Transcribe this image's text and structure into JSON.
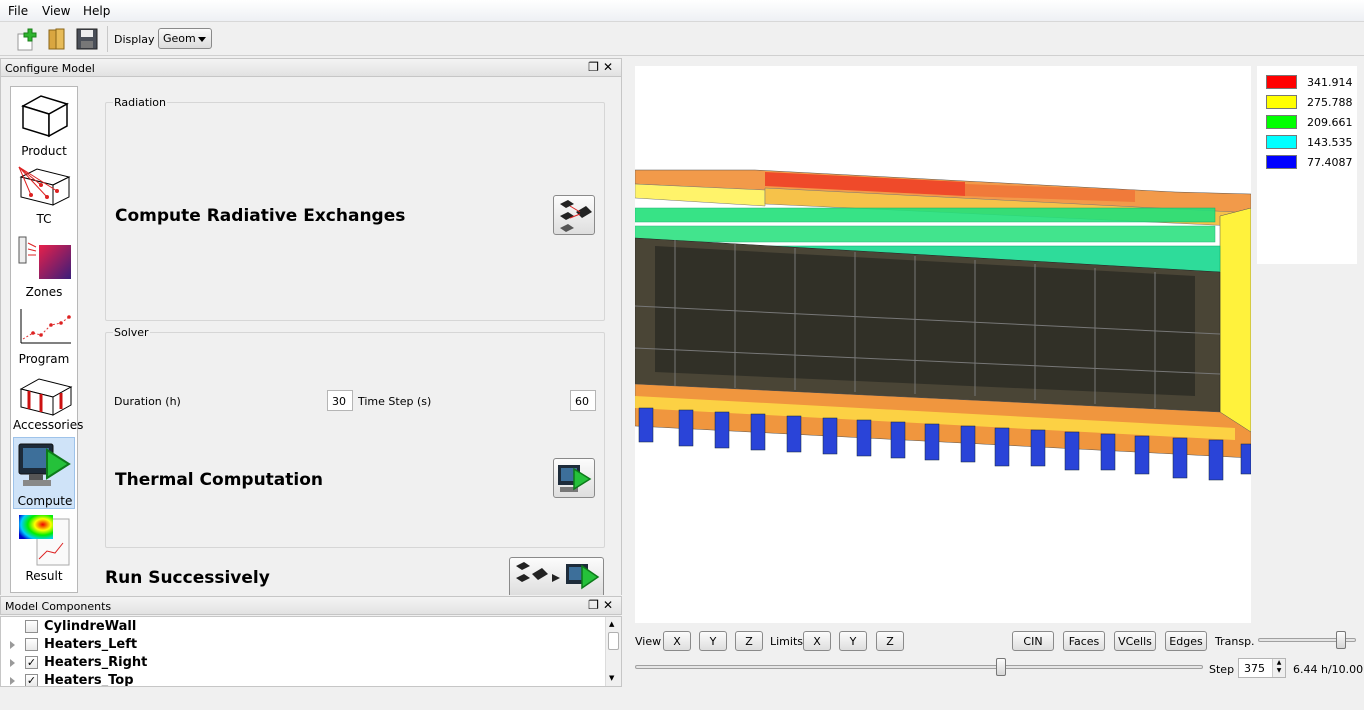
{
  "menu": {
    "items": [
      "File",
      "View",
      "Help"
    ]
  },
  "toolbar": {
    "display_label": "Display :",
    "display_value": "Geom"
  },
  "configure": {
    "title": "Configure Model",
    "nav": [
      {
        "label": "Product",
        "icon": "box-icon"
      },
      {
        "label": "TC",
        "icon": "thermocouple-icon"
      },
      {
        "label": "Zones",
        "icon": "heater-zone-icon"
      },
      {
        "label": "Program",
        "icon": "program-plot-icon"
      },
      {
        "label": "Accessories",
        "icon": "accessories-icon"
      },
      {
        "label": "Compute",
        "icon": "compute-play-icon"
      },
      {
        "label": "Result",
        "icon": "result-colormap-icon"
      }
    ],
    "radiation": {
      "group_title": "Radiation",
      "heading": "Compute Radiative Exchanges"
    },
    "solver": {
      "group_title": "Solver",
      "duration_label": "Duration (h)",
      "duration_value": "30",
      "timestep_label": "Time Step (s)",
      "timestep_value": "60",
      "heading": "Thermal Computation"
    },
    "run": {
      "heading": "Run Successively"
    }
  },
  "components": {
    "title": "Model Components",
    "items": [
      {
        "name": "CylindreWall",
        "checked": false,
        "expandable": false
      },
      {
        "name": "Heaters_Left",
        "checked": false,
        "expandable": true
      },
      {
        "name": "Heaters_Right",
        "checked": true,
        "expandable": true
      },
      {
        "name": "Heaters_Top",
        "checked": true,
        "expandable": true
      }
    ]
  },
  "legend": {
    "entries": [
      {
        "value": "341.914",
        "color": "#ff0000"
      },
      {
        "value": "275.788",
        "color": "#ffff00"
      },
      {
        "value": "209.661",
        "color": "#00ff00"
      },
      {
        "value": "143.535",
        "color": "#00ffff"
      },
      {
        "value": "77.4087",
        "color": "#0000ff"
      }
    ]
  },
  "view_controls": {
    "view_label": "View",
    "view_buttons": [
      "X",
      "Y",
      "Z"
    ],
    "limits_label": "Limits",
    "limit_buttons": [
      "X",
      "Y",
      "Z"
    ],
    "mode_buttons": [
      "CIN",
      "Faces",
      "VCells",
      "Edges"
    ],
    "transp_label": "Transp.",
    "transp_level": 0.85,
    "time_level": 0.644,
    "step_label": "Step",
    "step_value": "375",
    "time_readout": "6.44 h/10.00"
  }
}
